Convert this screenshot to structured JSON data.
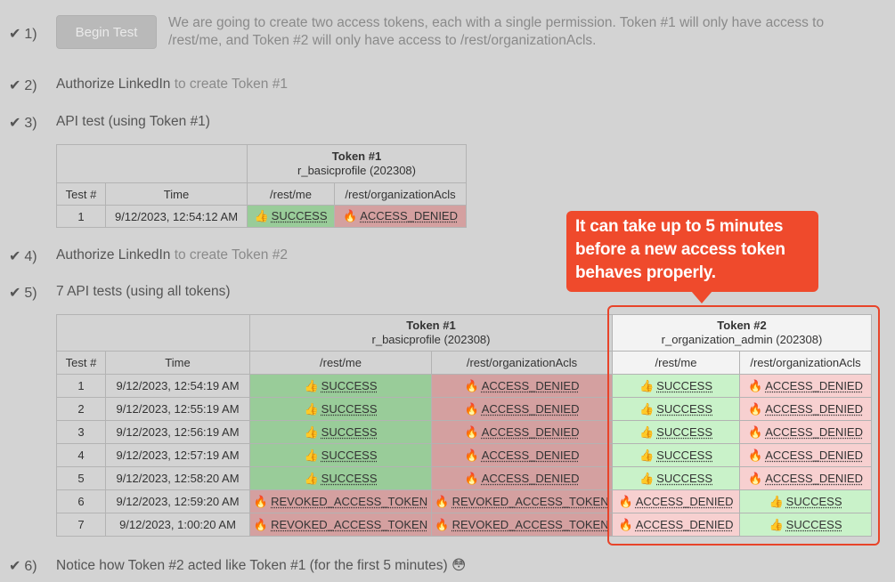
{
  "check": "✔",
  "steps": [
    {
      "num": "1)"
    },
    {
      "num": "2)",
      "title": "Authorize LinkedIn",
      "suffix": "to create Token #1"
    },
    {
      "num": "3)",
      "title": "API test (using Token #1)"
    },
    {
      "num": "4)",
      "title": "Authorize LinkedIn",
      "suffix": "to create Token #2"
    },
    {
      "num": "5)",
      "title": "7 API tests (using all tokens)"
    },
    {
      "num": "6)",
      "title": "Notice how Token #2 acted like Token #1 (for the first 5 minutes) 😳"
    }
  ],
  "begin_button": "Begin Test",
  "intro_text": "We are going to create two access tokens, each with a single permission. Token #1 will only have access to /rest/me, and Token #2 will only have access to /rest/organizationAcls.",
  "headers": {
    "test_num": "Test #",
    "time": "Time",
    "token1_name": "Token #1",
    "token1_scope": "r_basicprofile (202308)",
    "token2_name": "Token #2",
    "token2_scope": "r_organization_admin (202308)",
    "endpoint_me": "/rest/me",
    "endpoint_acls": "/rest/organizationAcls"
  },
  "status_icons": {
    "SUCCESS": "👍",
    "ACCESS_DENIED": "🔥",
    "REVOKED_ACCESS_TOKEN": "🔥"
  },
  "colors": {
    "success": "#99cc99",
    "failure": "#d4a0a0",
    "callout": "#ef4a2c"
  },
  "test1": [
    {
      "n": "1",
      "time": "9/12/2023, 12:54:12 AM",
      "t1_me": "SUCCESS",
      "t1_acls": "ACCESS_DENIED"
    }
  ],
  "test2": [
    {
      "n": "1",
      "time": "9/12/2023, 12:54:19 AM",
      "t1_me": "SUCCESS",
      "t1_acls": "ACCESS_DENIED",
      "t2_me": "SUCCESS",
      "t2_acls": "ACCESS_DENIED"
    },
    {
      "n": "2",
      "time": "9/12/2023, 12:55:19 AM",
      "t1_me": "SUCCESS",
      "t1_acls": "ACCESS_DENIED",
      "t2_me": "SUCCESS",
      "t2_acls": "ACCESS_DENIED"
    },
    {
      "n": "3",
      "time": "9/12/2023, 12:56:19 AM",
      "t1_me": "SUCCESS",
      "t1_acls": "ACCESS_DENIED",
      "t2_me": "SUCCESS",
      "t2_acls": "ACCESS_DENIED"
    },
    {
      "n": "4",
      "time": "9/12/2023, 12:57:19 AM",
      "t1_me": "SUCCESS",
      "t1_acls": "ACCESS_DENIED",
      "t2_me": "SUCCESS",
      "t2_acls": "ACCESS_DENIED"
    },
    {
      "n": "5",
      "time": "9/12/2023, 12:58:20 AM",
      "t1_me": "SUCCESS",
      "t1_acls": "ACCESS_DENIED",
      "t2_me": "SUCCESS",
      "t2_acls": "ACCESS_DENIED"
    },
    {
      "n": "6",
      "time": "9/12/2023, 12:59:20 AM",
      "t1_me": "REVOKED_ACCESS_TOKEN",
      "t1_acls": "REVOKED_ACCESS_TOKEN",
      "t2_me": "ACCESS_DENIED",
      "t2_acls": "SUCCESS"
    },
    {
      "n": "7",
      "time": "9/12/2023, 1:00:20 AM",
      "t1_me": "REVOKED_ACCESS_TOKEN",
      "t1_acls": "REVOKED_ACCESS_TOKEN",
      "t2_me": "ACCESS_DENIED",
      "t2_acls": "SUCCESS"
    }
  ],
  "callout_text": "It can take up to 5 minutes before a new access token behaves properly."
}
